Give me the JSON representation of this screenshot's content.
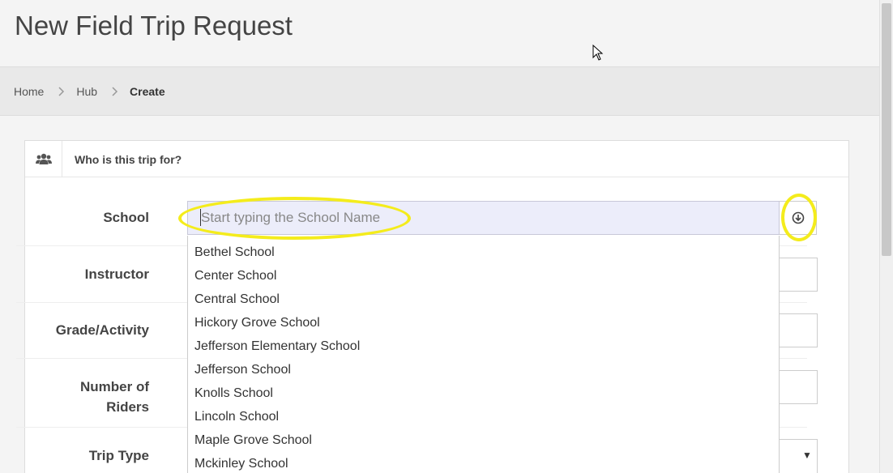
{
  "page": {
    "title": "New Field Trip Request"
  },
  "breadcrumb": {
    "items": [
      {
        "label": "Home"
      },
      {
        "label": "Hub"
      },
      {
        "label": "Create"
      }
    ]
  },
  "panel": {
    "icon": "users-icon",
    "heading": "Who is this trip for?"
  },
  "form": {
    "school": {
      "label": "School",
      "placeholder": "Start typing the School Name",
      "value": "",
      "dropdown_icon": "circle-arrow-down-icon"
    },
    "instructor": {
      "label": "Instructor"
    },
    "grade_activity": {
      "label": "Grade/Activity"
    },
    "riders": {
      "label_line1": "Number of",
      "label_line2": "Riders"
    },
    "trip_type": {
      "label": "Trip Type",
      "select_icon": "caret-down-icon"
    }
  },
  "school_options": [
    "Bethel School",
    "Center School",
    "Central School",
    "Hickory Grove School",
    "Jefferson Elementary School",
    "Jefferson School",
    "Knolls School",
    "Lincoln School",
    "Maple Grove School",
    "Mckinley School"
  ],
  "colors": {
    "highlight": "#f4ec1c",
    "input_focus_bg": "#ecedfa"
  }
}
